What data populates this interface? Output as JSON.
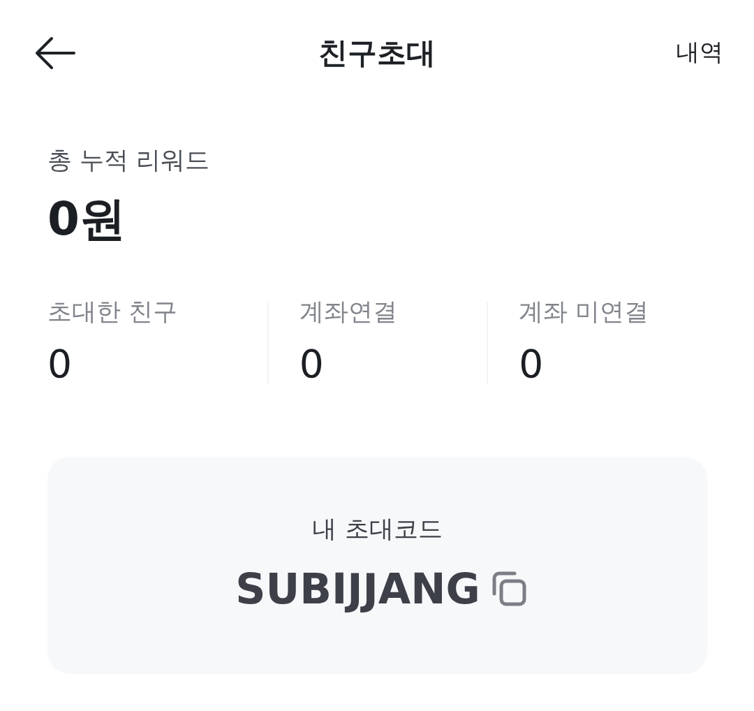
{
  "header": {
    "title": "친구초대",
    "action": "내역"
  },
  "total_reward": {
    "label": "총 누적 리워드",
    "amount": "0원"
  },
  "stats": [
    {
      "label": "초대한 친구",
      "value": "0"
    },
    {
      "label": "계좌연결",
      "value": "0"
    },
    {
      "label": "계좌 미연결",
      "value": "0"
    }
  ],
  "invite_code": {
    "label": "내 초대코드",
    "code": "SUBIJJANG"
  }
}
